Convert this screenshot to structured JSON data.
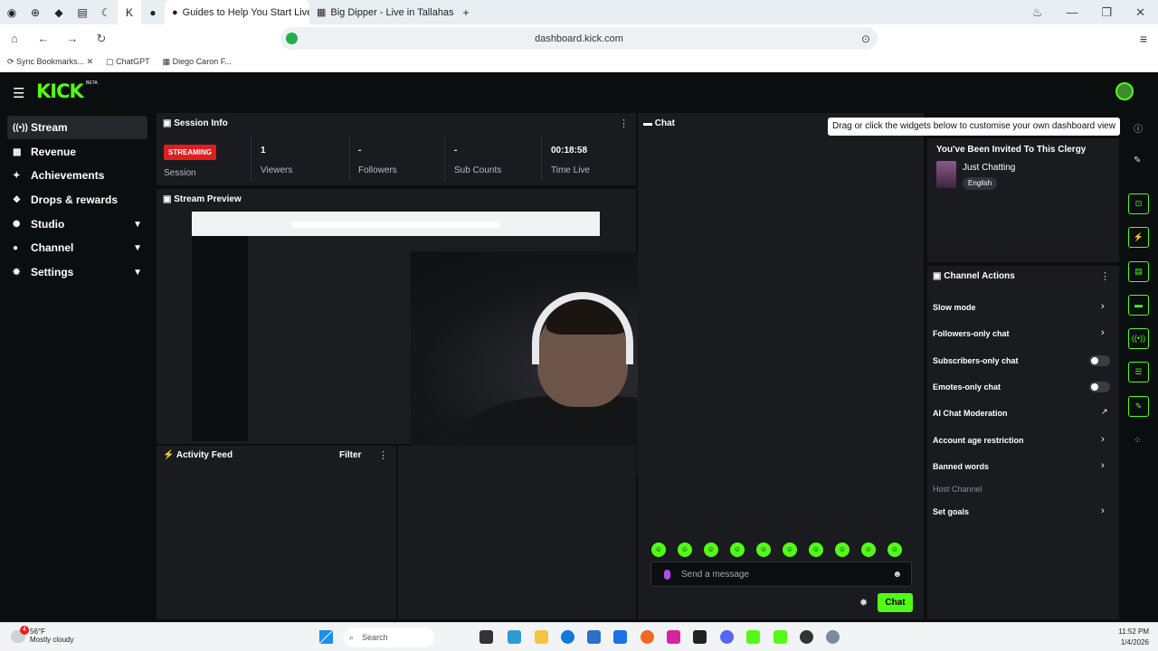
{
  "browser": {
    "tabs": [
      {
        "label": "Guides to Help You Start Live Strea"
      },
      {
        "label": "Big Dipper - Live in Tallahassee, Tal"
      }
    ],
    "url": "dashboard.kick.com",
    "bookmarks": [
      "Sync Bookmarks...",
      "ChatGPT",
      "Diego Caron F..."
    ]
  },
  "header": {
    "logo": "KICK",
    "beta": "BETA"
  },
  "sidebar": {
    "items": [
      {
        "label": "Stream",
        "icon": "broadcast-icon"
      },
      {
        "label": "Revenue",
        "icon": "revenue-icon"
      },
      {
        "label": "Achievements",
        "icon": "achievements-icon"
      },
      {
        "label": "Drops & rewards",
        "icon": "drops-icon"
      },
      {
        "label": "Studio",
        "icon": "studio-icon"
      },
      {
        "label": "Channel",
        "icon": "channel-icon"
      },
      {
        "label": "Settings",
        "icon": "gear-icon"
      }
    ]
  },
  "session": {
    "title": "Session Info",
    "status": "STREAMING",
    "status_label": "Session",
    "viewers": "1",
    "viewers_label": "Viewers",
    "followers": "-",
    "followers_label": "Followers",
    "subs": "-",
    "subs_label": "Sub Counts",
    "time": "00:18:58",
    "time_label": "Time Live"
  },
  "preview": {
    "title": "Stream Preview"
  },
  "activity": {
    "title": "Activity Feed",
    "filter": "Filter"
  },
  "chat": {
    "title": "Chat",
    "placeholder": "Send a message",
    "send": "Chat"
  },
  "tooltip": "Drag or click the widgets below to customise your own dashboard view",
  "invite": {
    "title": "You've Been Invited To This Clergy",
    "category": "Just Chatting",
    "language": "English"
  },
  "channel_actions": {
    "title": "Channel Actions",
    "items": [
      {
        "label": "Slow mode",
        "control": "chevron"
      },
      {
        "label": "Followers-only chat",
        "control": "chevron"
      },
      {
        "label": "Subscribers-only chat",
        "control": "toggle"
      },
      {
        "label": "Emotes-only chat",
        "control": "toggle"
      },
      {
        "label": "AI Chat Moderation",
        "control": "external"
      },
      {
        "label": "Account age restriction",
        "control": "chevron"
      },
      {
        "label": "Banned words",
        "control": "chevron"
      },
      {
        "label": "Host Channel",
        "control": "none"
      },
      {
        "label": "Set goals",
        "control": "chevron"
      }
    ]
  },
  "taskbar": {
    "weather_temp": "56°F",
    "weather_desc": "Mostly cloudy",
    "search": "Search",
    "time": "11:52 PM",
    "date": "1/4/2026",
    "notif_count": "4"
  },
  "colors": {
    "accent": "#53fc18",
    "streaming": "#e21d1d",
    "panel": "#191b1f"
  }
}
